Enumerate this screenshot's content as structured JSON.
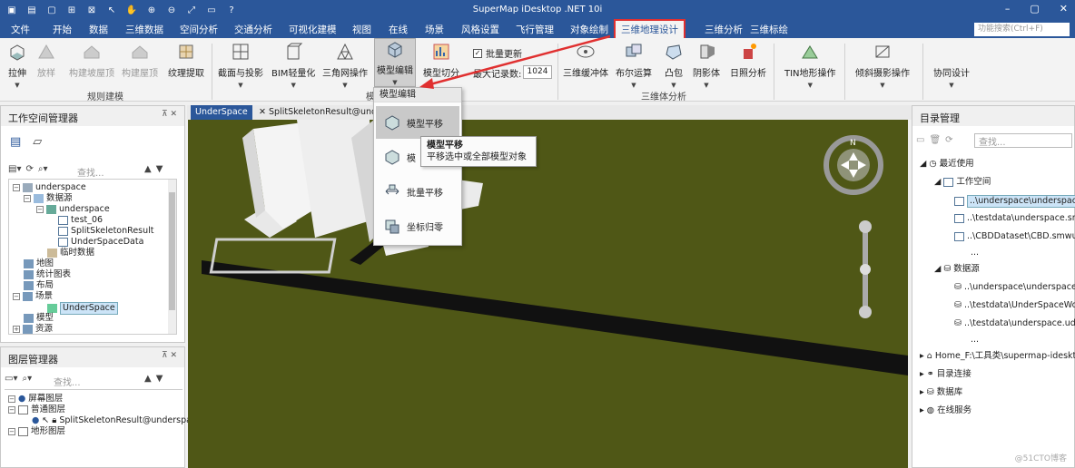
{
  "app_title": "SuperMap iDesktop .NET 10i",
  "menu": [
    "文件",
    "开始",
    "数据",
    "三维数据",
    "空间分析",
    "交通分析",
    "可视化建模",
    "视图",
    "在线",
    "场景",
    "风格设置",
    "飞行管理",
    "对象绘制",
    "三维地理设计",
    "三维分析",
    "三维标绘"
  ],
  "function_search_placeholder": "功能搜索(Ctrl+F)",
  "ribbon": {
    "extrude": "拉伸",
    "lofting": "放样",
    "build_terrain_rooftop": "构建坡屋顶",
    "build_roof": "构建屋顶",
    "texture_extract": "纹理提取",
    "section_projection": "截面与投影",
    "bim_lightweight": "BIM轻量化",
    "triangle_mesh_op": "三角网操作",
    "model_edit": "模型编辑",
    "model_cut": "模型切分",
    "batch_update": "批量更新",
    "max_records_label": "最大记录数:",
    "max_records_value": "1024",
    "solid_3d": "三维缓冲体",
    "boolean_op": "布尔运算",
    "convex_hull": "凸包",
    "shadow_volume": "阴影体",
    "sunlight_analysis": "日照分析",
    "tin_terrain_op": "TIN地形操作",
    "oblique_photo_op": "倾斜摄影操作",
    "collab_design": "协同设计",
    "group_rule_modeling": "规则建模",
    "group_model": "模",
    "group_3d_analysis": "三维体分析"
  },
  "workspace_panel": {
    "title": "工作空间管理器",
    "search_placeholder": "查找...",
    "tree": [
      {
        "label": "underspace"
      },
      {
        "label": "数据源"
      },
      {
        "label": "underspace"
      },
      {
        "label": "test_06"
      },
      {
        "label": "SplitSkeletonResult"
      },
      {
        "label": "UnderSpaceData"
      },
      {
        "label": "临时数据"
      },
      {
        "label": "地图"
      },
      {
        "label": "统计图表"
      },
      {
        "label": "布局"
      },
      {
        "label": "场景"
      },
      {
        "label": "UnderSpace"
      },
      {
        "label": "模型"
      },
      {
        "label": "资源"
      }
    ]
  },
  "layer_panel": {
    "title": "图层管理器",
    "search_placeholder": "查找...",
    "tree": [
      {
        "label": "屏幕图层"
      },
      {
        "label": "普通图层"
      },
      {
        "label": "SplitSkeletonResult@underspace"
      },
      {
        "label": "地形图层"
      }
    ]
  },
  "view_tabs": [
    "UnderSpace",
    "SplitSkeletonResult@underspace"
  ],
  "dropdown": {
    "header": "模型编辑",
    "items": [
      "模型平移",
      "模",
      "批量平移",
      "坐标归零"
    ]
  },
  "tooltip": {
    "title": "模型平移",
    "desc": "平移选中或全部模型对象"
  },
  "catalog_panel": {
    "title": "目录管理",
    "search_placeholder": "查找...",
    "tree": [
      {
        "label": "最近使用"
      },
      {
        "label": "工作空间"
      },
      {
        "label": "..\\underspace\\underspace.smwu"
      },
      {
        "label": "..\\testdata\\underspace.smwu"
      },
      {
        "label": "..\\CBDDataset\\CBD.smwu"
      },
      {
        "label": "..."
      },
      {
        "label": "数据源"
      },
      {
        "label": "..\\underspace\\underspace.udbx"
      },
      {
        "label": "..\\testdata\\UnderSpaceWork.udbx"
      },
      {
        "label": "..\\testdata\\underspace.udb"
      },
      {
        "label": "..."
      },
      {
        "label": "Home_F:\\工具类\\supermap-idesktop"
      },
      {
        "label": "目录连接"
      },
      {
        "label": "数据库"
      },
      {
        "label": "在线服务"
      }
    ]
  },
  "watermark": "@51CTO博客",
  "colors": {
    "accent": "#2b579a",
    "highlight_red": "#e03030",
    "ground": "#4f5716"
  }
}
